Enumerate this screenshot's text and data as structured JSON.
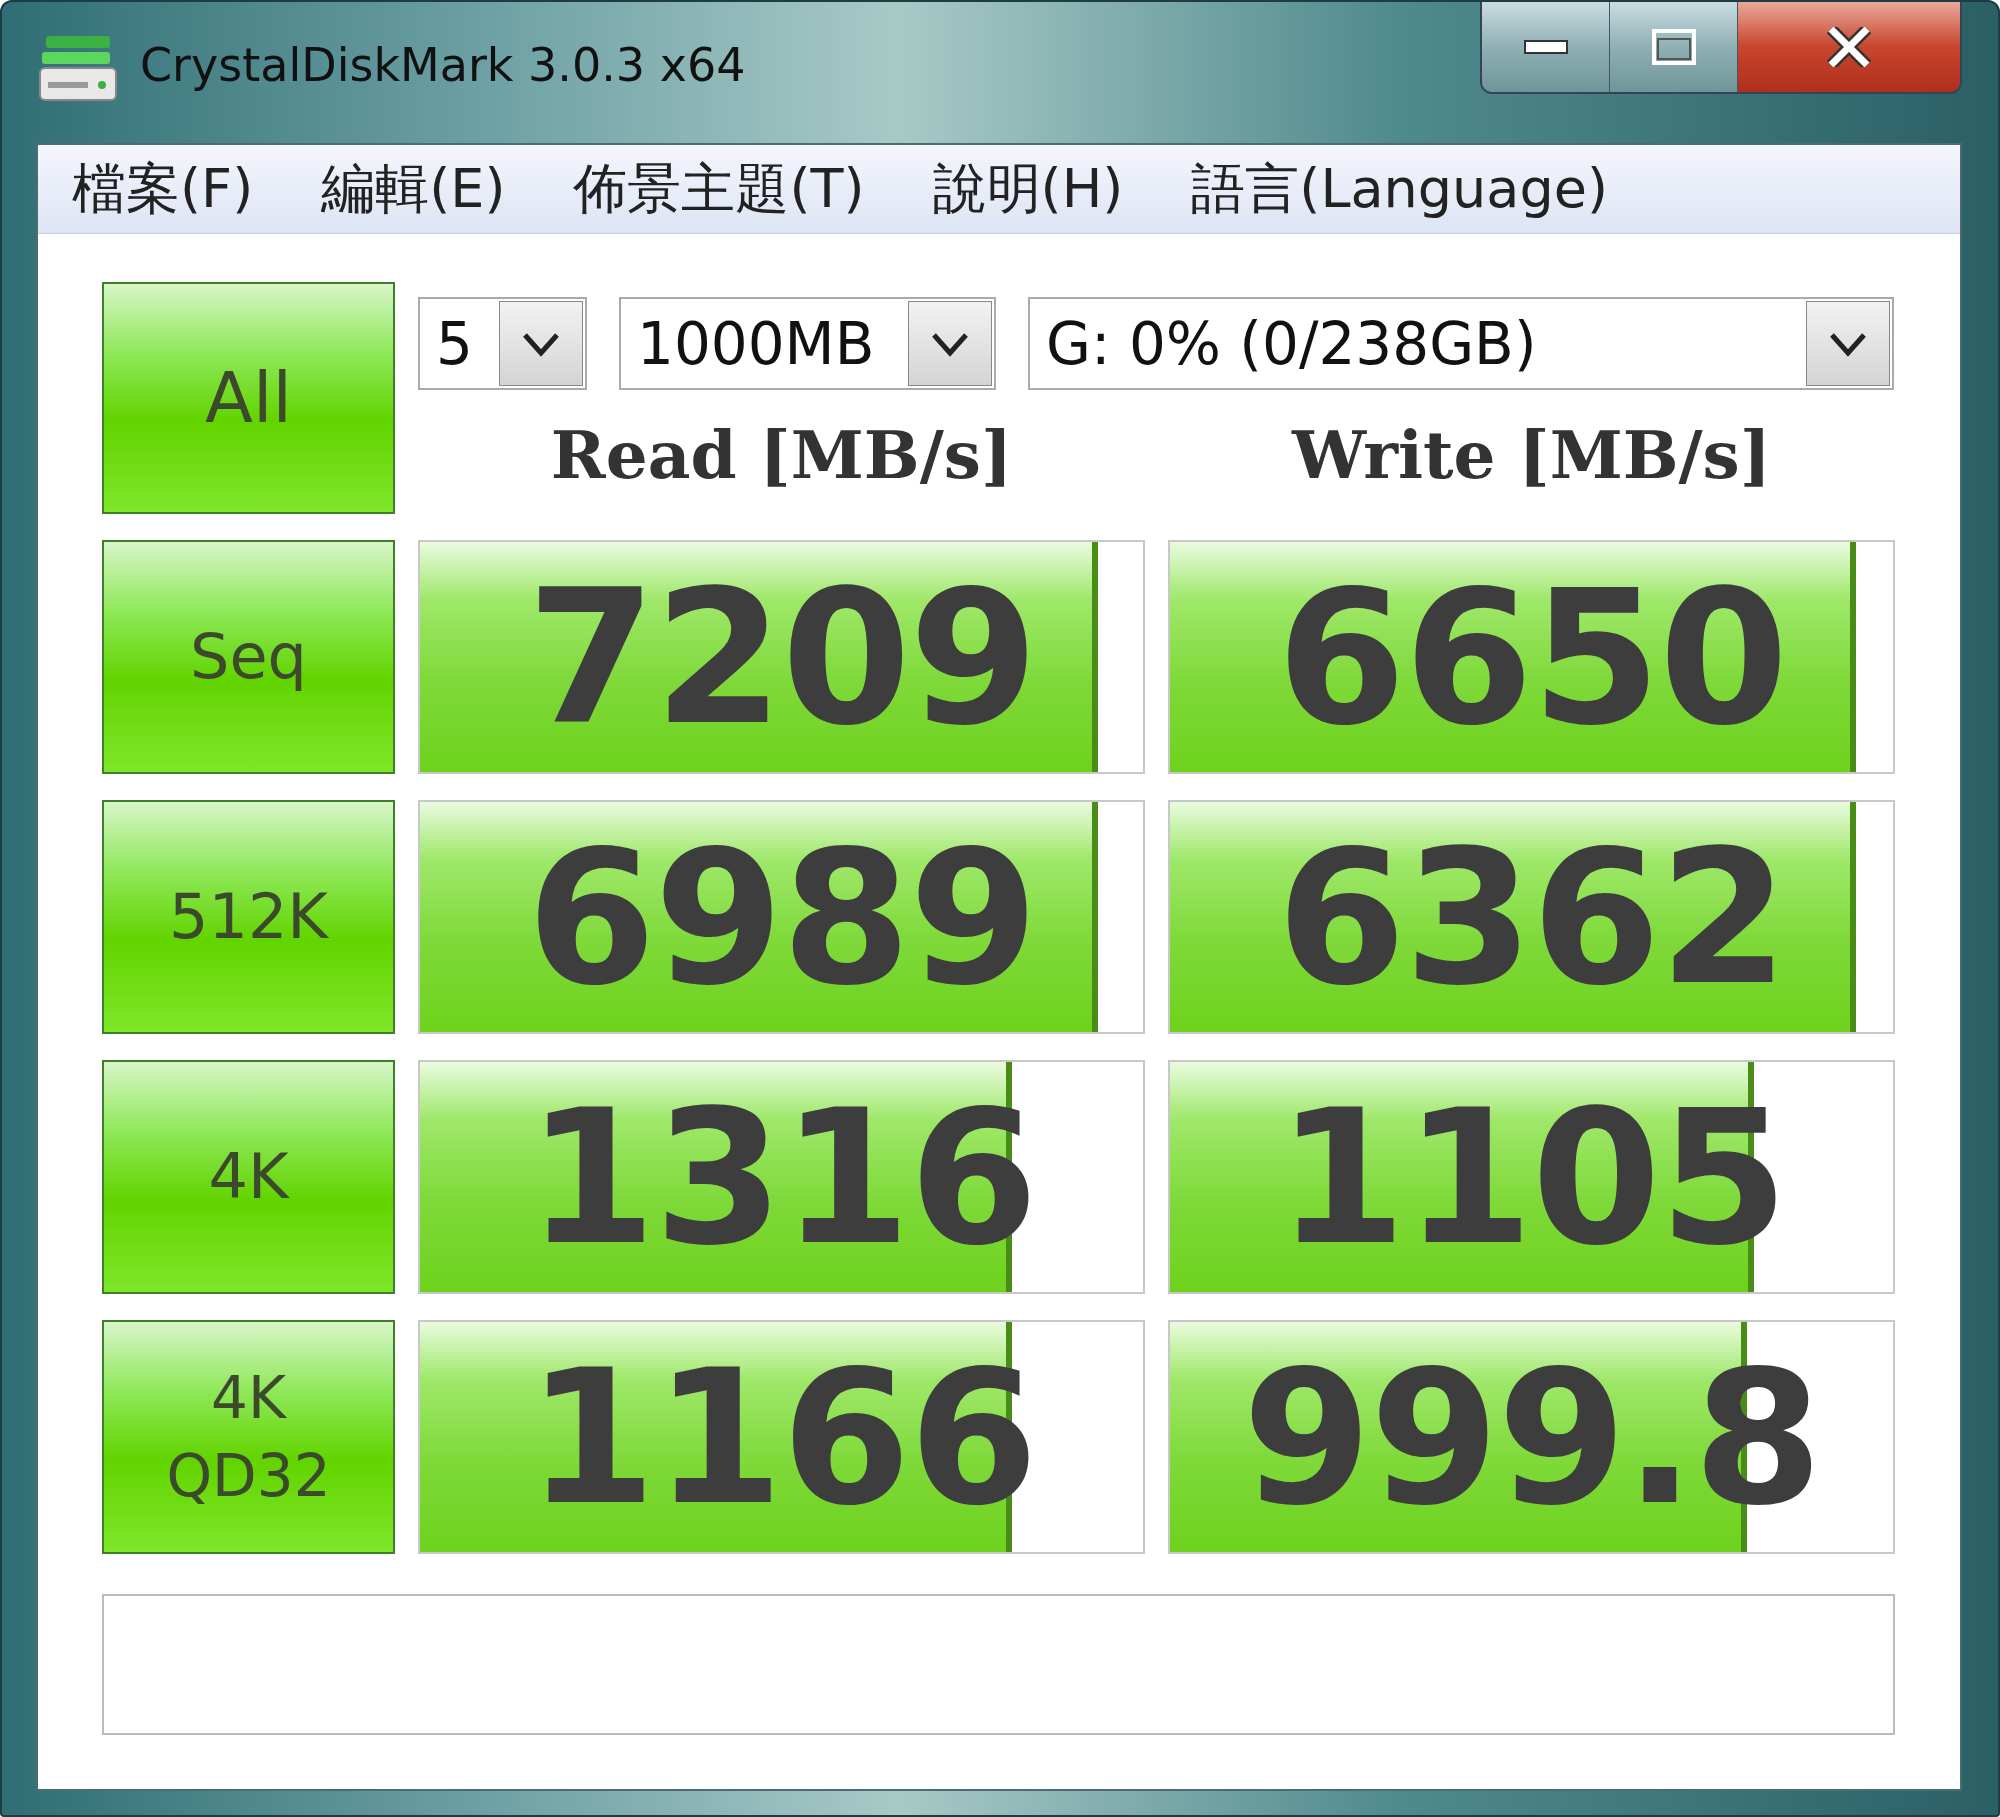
{
  "window": {
    "title": "CrystalDiskMark 3.0.3 x64"
  },
  "menu": [
    {
      "label": "檔案(F)"
    },
    {
      "label": "編輯(E)"
    },
    {
      "label": "佈景主題(T)"
    },
    {
      "label": "說明(H)"
    },
    {
      "label": "語言(Language)"
    }
  ],
  "all_button": {
    "label": "All"
  },
  "selectors": [
    {
      "value": "5"
    },
    {
      "value": "1000MB"
    },
    {
      "value": "G: 0% (0/238GB)"
    }
  ],
  "columns": [
    "Read [MB/s]",
    "Write [MB/s]"
  ],
  "tests": [
    {
      "label": [
        "Seq"
      ],
      "read": {
        "value": "7209",
        "level": 0.93
      },
      "write": {
        "value": "6650",
        "level": 0.94
      }
    },
    {
      "label": [
        "512K"
      ],
      "read": {
        "value": "6989",
        "level": 0.93
      },
      "write": {
        "value": "6362",
        "level": 0.94
      }
    },
    {
      "label": [
        "4K"
      ],
      "read": {
        "value": "1316",
        "level": 0.81
      },
      "write": {
        "value": "1105",
        "level": 0.8
      }
    },
    {
      "label": [
        "4K",
        "QD32"
      ],
      "read": {
        "value": "1166",
        "level": 0.81
      },
      "write": {
        "value": "999.8",
        "level": 0.79
      }
    }
  ]
}
